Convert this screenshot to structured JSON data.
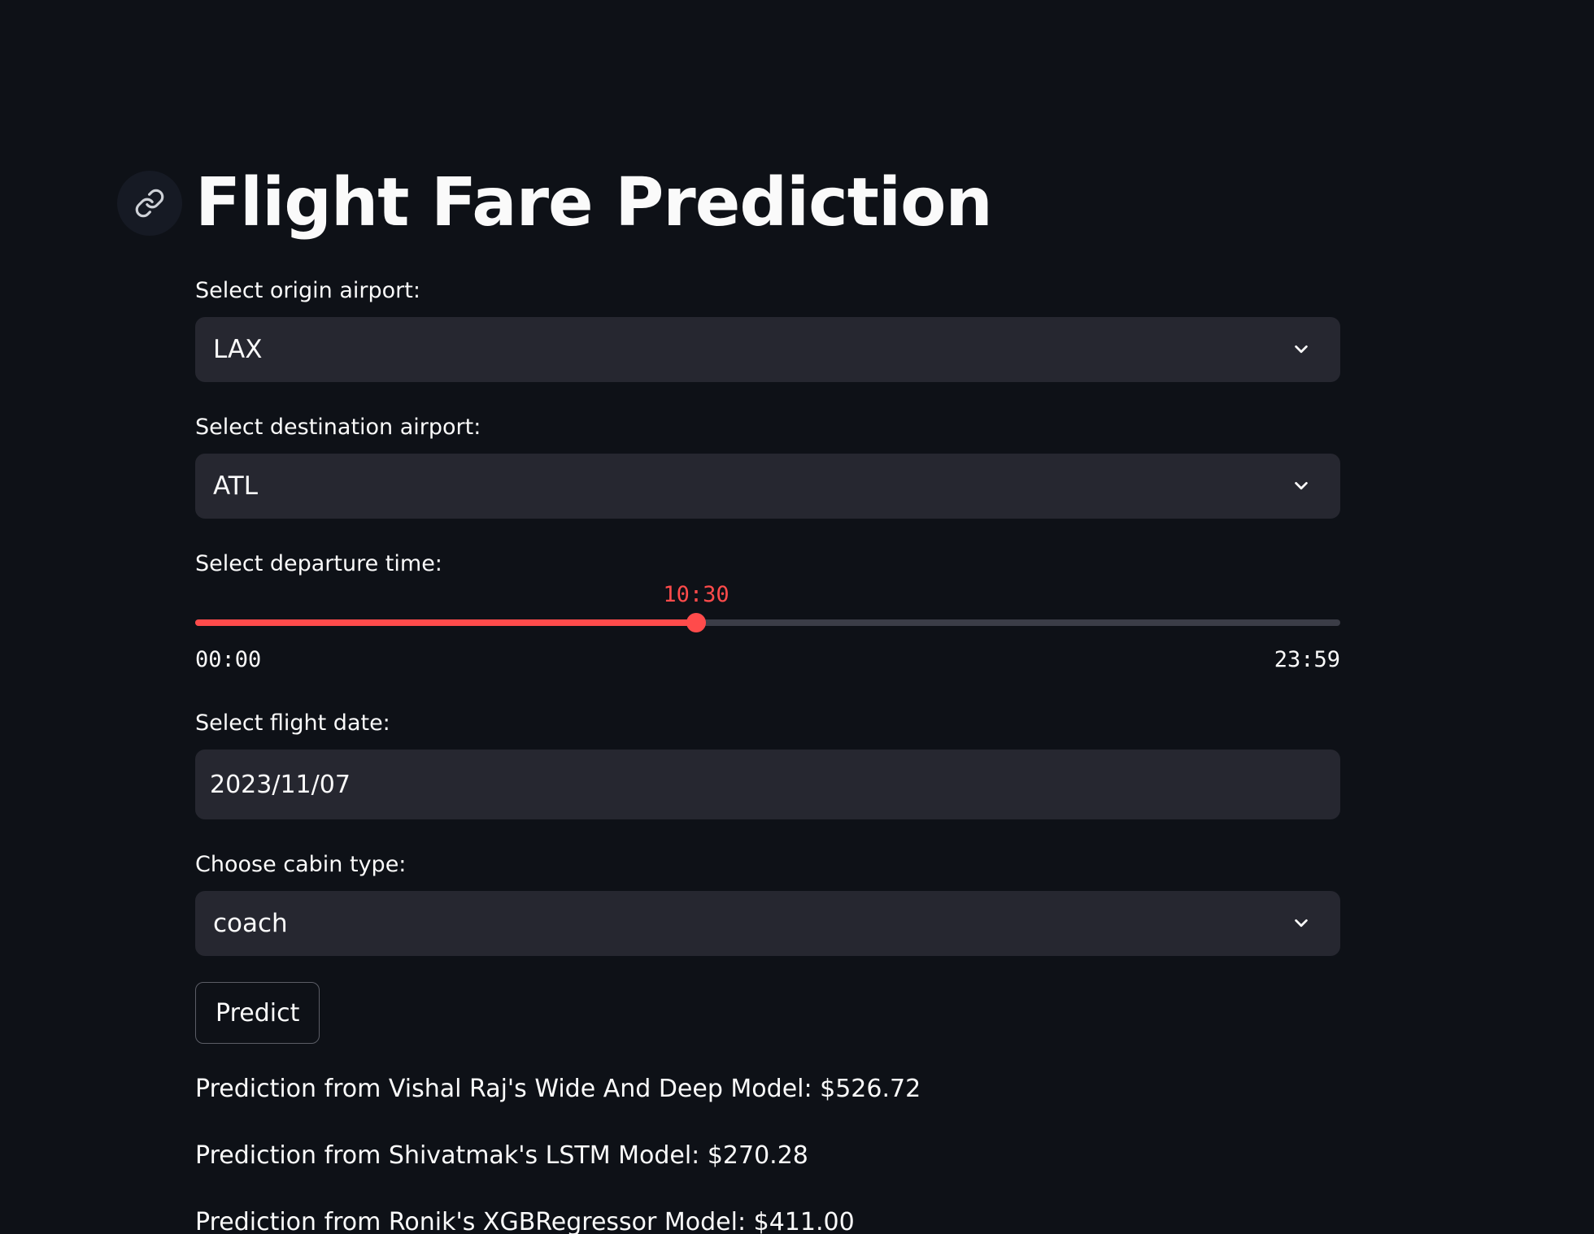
{
  "header": {
    "title": "Flight Fare Prediction",
    "anchor_icon": "link-icon"
  },
  "form": {
    "origin": {
      "label": "Select origin airport:",
      "value": "LAX"
    },
    "destination": {
      "label": "Select destination airport:",
      "value": "ATL"
    },
    "departure_time": {
      "label": "Select departure time:",
      "value": "10:30",
      "min": "00:00",
      "max": "23:59",
      "fraction": 0.4375
    },
    "flight_date": {
      "label": "Select flight date:",
      "value": "2023/11/07"
    },
    "cabin": {
      "label": "Choose cabin type:",
      "value": "coach"
    },
    "predict_label": "Predict"
  },
  "results": [
    "Prediction from Vishal Raj's Wide And Deep Model: $526.72",
    "Prediction from Shivatmak's LSTM Model: $270.28",
    "Prediction from Ronik's XGBRegressor Model: $411.00"
  ],
  "colors": {
    "background": "#0e1117",
    "input_bg": "#262730",
    "accent": "#ff4b4b",
    "text": "#fafafa"
  }
}
